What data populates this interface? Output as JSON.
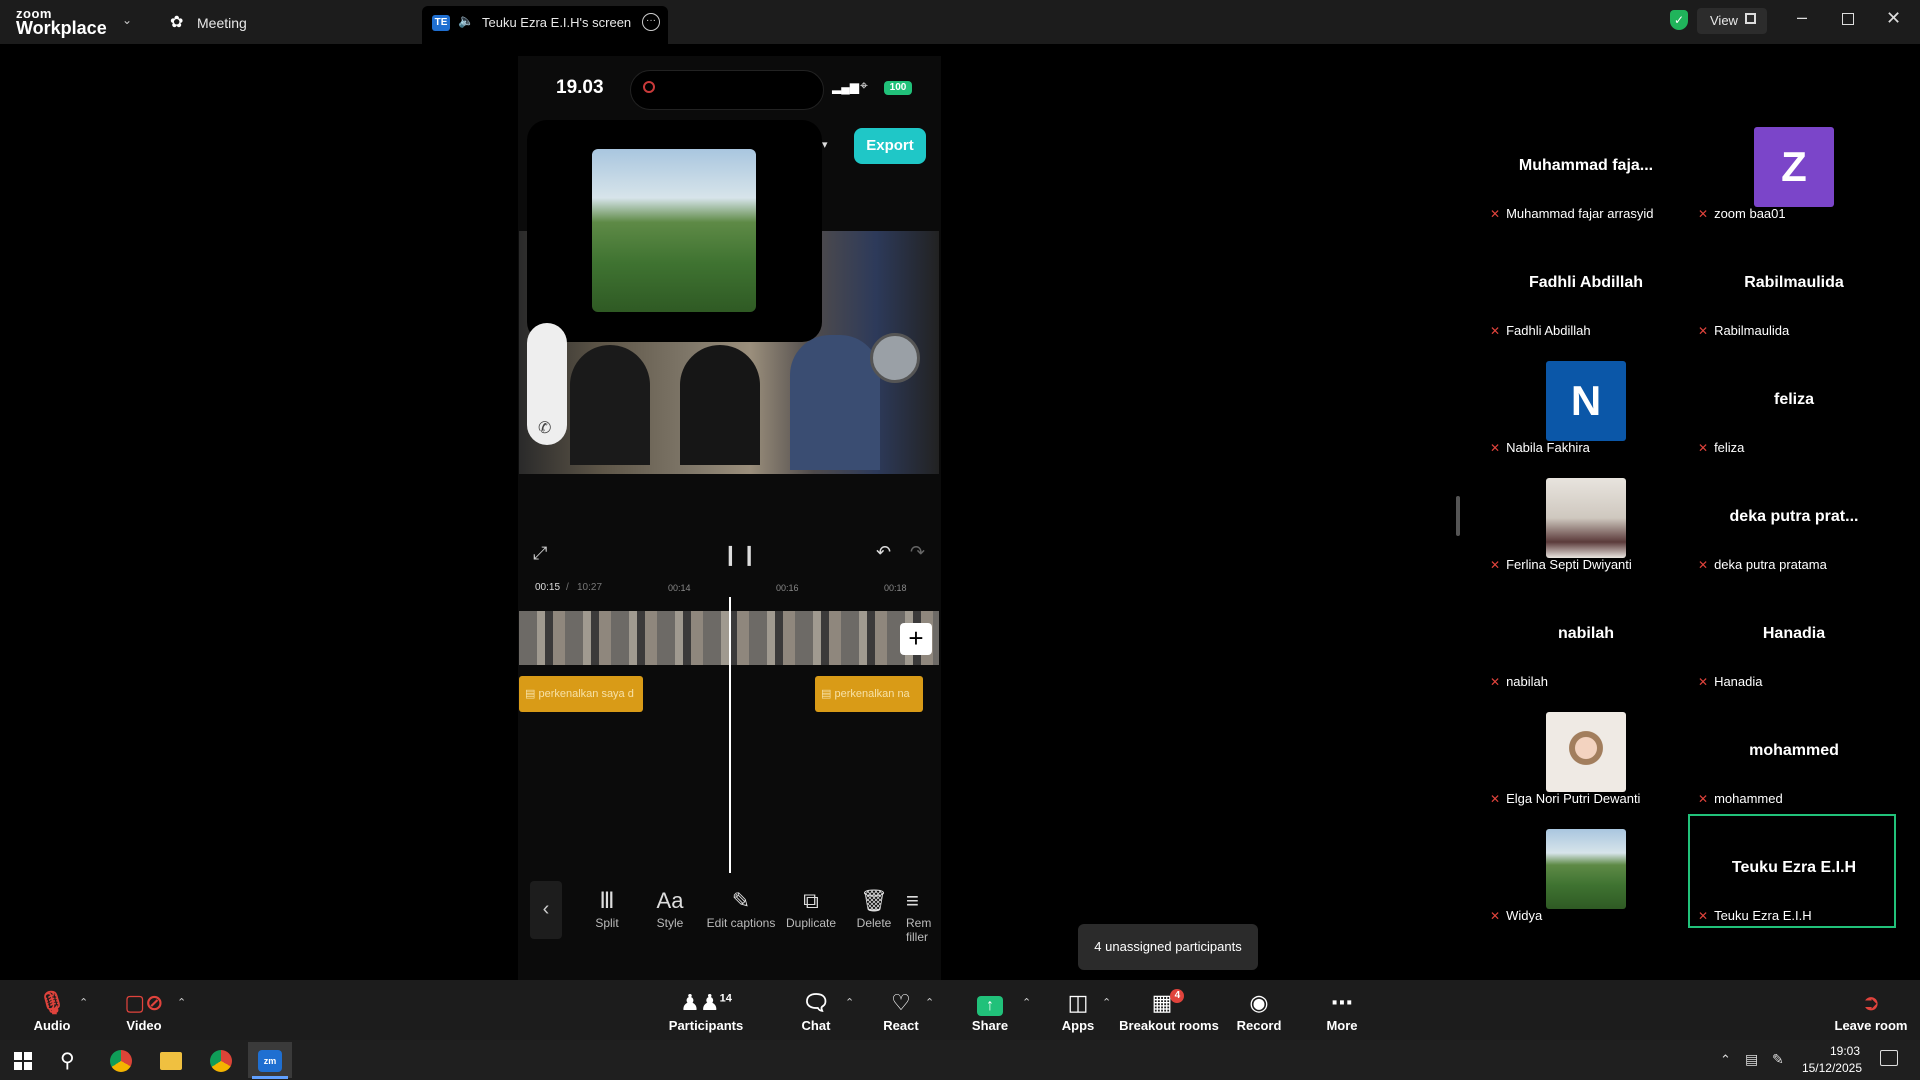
{
  "app": {
    "logo_top": "zoom",
    "logo_bottom": "Workplace"
  },
  "tabs": {
    "meeting": "Meeting",
    "screen_badge": "TE",
    "screen_tab": "Teuku Ezra E.I.H's screen"
  },
  "window": {
    "view_label": "View"
  },
  "phone": {
    "time": "19.03",
    "battery": "100",
    "export_label": "Export",
    "time_current": "00:15",
    "time_total": "10:27",
    "ticks": [
      "00:14",
      "00:16",
      "00:18"
    ],
    "caption1": "perkenalkan saya d",
    "caption2": "perkenalkan na",
    "tools": [
      "Split",
      "Style",
      "Edit captions",
      "Duplicate",
      "Delete",
      "Rem filler"
    ]
  },
  "participants": [
    {
      "tile_name": "Muhammad  faja...",
      "label": "Muhammad fajar arrasyid",
      "avatar": null
    },
    {
      "tile_name": "",
      "label": "zoom baa01",
      "avatar": "Z",
      "avatar_color": "#7b45c9"
    },
    {
      "tile_name": "Fadhli Abdillah",
      "label": "Fadhli Abdillah",
      "avatar": null
    },
    {
      "tile_name": "Rabilmaulida",
      "label": "Rabilmaulida",
      "avatar": null
    },
    {
      "tile_name": "",
      "label": "Nabila Fakhira",
      "avatar": "N",
      "avatar_color": "#0b57a8"
    },
    {
      "tile_name": "feliza",
      "label": "feliza",
      "avatar": null
    },
    {
      "tile_name": "",
      "label": "Ferlina Septi Dwiyanti",
      "avatar": "photo-room"
    },
    {
      "tile_name": "deka putra prat...",
      "label": "deka putra pratama",
      "avatar": null
    },
    {
      "tile_name": "nabilah",
      "label": "nabilah",
      "avatar": null
    },
    {
      "tile_name": "Hanadia",
      "label": "Hanadia",
      "avatar": null
    },
    {
      "tile_name": "",
      "label": "Elga Nori Putri Dewanti",
      "avatar": "photo-cartoon"
    },
    {
      "tile_name": "mohammed",
      "label": "mohammed",
      "avatar": null
    },
    {
      "tile_name": "",
      "label": "Widya",
      "avatar": "photo-landscape"
    },
    {
      "tile_name": "Teuku Ezra E.I.H",
      "label": "Teuku Ezra E.I.H",
      "avatar": null,
      "active": true
    }
  ],
  "tooltip": "4 unassigned participants",
  "toolbar": {
    "audio": "Audio",
    "video": "Video",
    "participants_count": "14",
    "participants": "Participants",
    "chat": "Chat",
    "react": "React",
    "share": "Share",
    "apps": "Apps",
    "breakout_badge": "4",
    "breakout": "Breakout rooms",
    "record": "Record",
    "more": "More",
    "leave": "Leave room"
  },
  "taskbar": {
    "time": "19:03",
    "date": "15/12/2025"
  },
  "colors": {
    "accent_green": "#21c17a",
    "export_teal": "#1fc7c7",
    "mic_red": "#e0433c",
    "caption_orange": "#d99b17"
  }
}
